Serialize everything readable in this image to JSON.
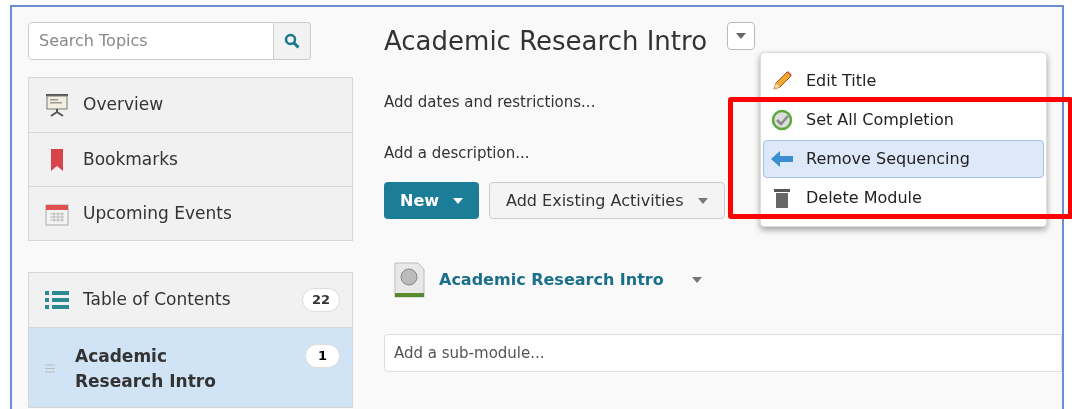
{
  "sidebar": {
    "search": {
      "placeholder": "Search Topics"
    },
    "nav_items": [
      {
        "label": "Overview",
        "kind": "overview"
      },
      {
        "label": "Bookmarks",
        "kind": "bookmark"
      },
      {
        "label": "Upcoming Events",
        "kind": "calendar"
      }
    ],
    "toc": {
      "label": "Table of Contents",
      "count": "22"
    },
    "modules": [
      {
        "label": "Academic Research Intro",
        "count": "1",
        "selected": true
      }
    ]
  },
  "main": {
    "title": "Academic Research Intro",
    "links": [
      "Add dates and restrictions...",
      "Add a description..."
    ],
    "buttons": [
      {
        "label": "New",
        "kind": "primary"
      },
      {
        "label": "Add Existing Activities",
        "kind": "secondary"
      }
    ],
    "module": {
      "label": "Academic Research Intro"
    },
    "submodule": {
      "placeholder": "Add a sub-module..."
    },
    "menu": [
      {
        "label": "Edit Title",
        "kind": "pencil",
        "selected": false
      },
      {
        "label": "Set All Completion",
        "kind": "check",
        "selected": false
      },
      {
        "label": "Remove Sequencing",
        "kind": "arrow",
        "selected": true
      },
      {
        "label": "Delete Module",
        "kind": "trash",
        "selected": false
      }
    ]
  }
}
